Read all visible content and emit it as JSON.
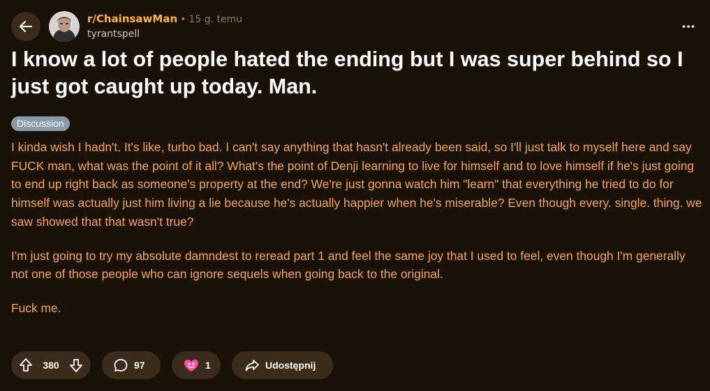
{
  "post": {
    "subreddit": "r/ChainsawMan",
    "separator": "•",
    "time_ago": "15 g. temu",
    "author": "tyrantspell",
    "title": "I know a lot of people hated the ending but I was super behind so I just got caught up today. Man.",
    "flair": "Discussion",
    "paragraphs": [
      "I kinda wish I hadn't. It's like, turbo bad. I can't say anything that hasn't already been said, so I'll just talk to myself here and say FUCK man, what was the point of it all? What's the point of Denji learning to live for himself and to love himself if he's just going to end up right back as someone's property at the end? We're just gonna watch him \"learn\" that everything he tried to do for himself was actually just him living a lie because he's actually happier when he's miserable? Even though every. single. thing. we saw showed that that wasn't true?",
      "I'm just going to try my absolute damndest to reread part 1 and feel the same joy that I used to feel, even though I'm generally not one of those people who can ignore sequels when going back to the original.",
      "Fuck me."
    ]
  },
  "actions": {
    "votes": "380",
    "comments": "97",
    "awards": "1",
    "share_label": "Udostępnij"
  },
  "colors": {
    "background": "#1a1209",
    "body_text": "#f5a55a",
    "subreddit": "#ffb347",
    "pill": "#3a2b1a",
    "flair": "#8a9aa8"
  },
  "icons": {
    "back": "arrow-left-icon",
    "more": "more-horizontal-icon",
    "upvote": "upvote-arrow-icon",
    "downvote": "downvote-arrow-icon",
    "comment": "speech-bubble-icon",
    "award": "heart-award-icon",
    "share": "share-arrow-icon"
  }
}
